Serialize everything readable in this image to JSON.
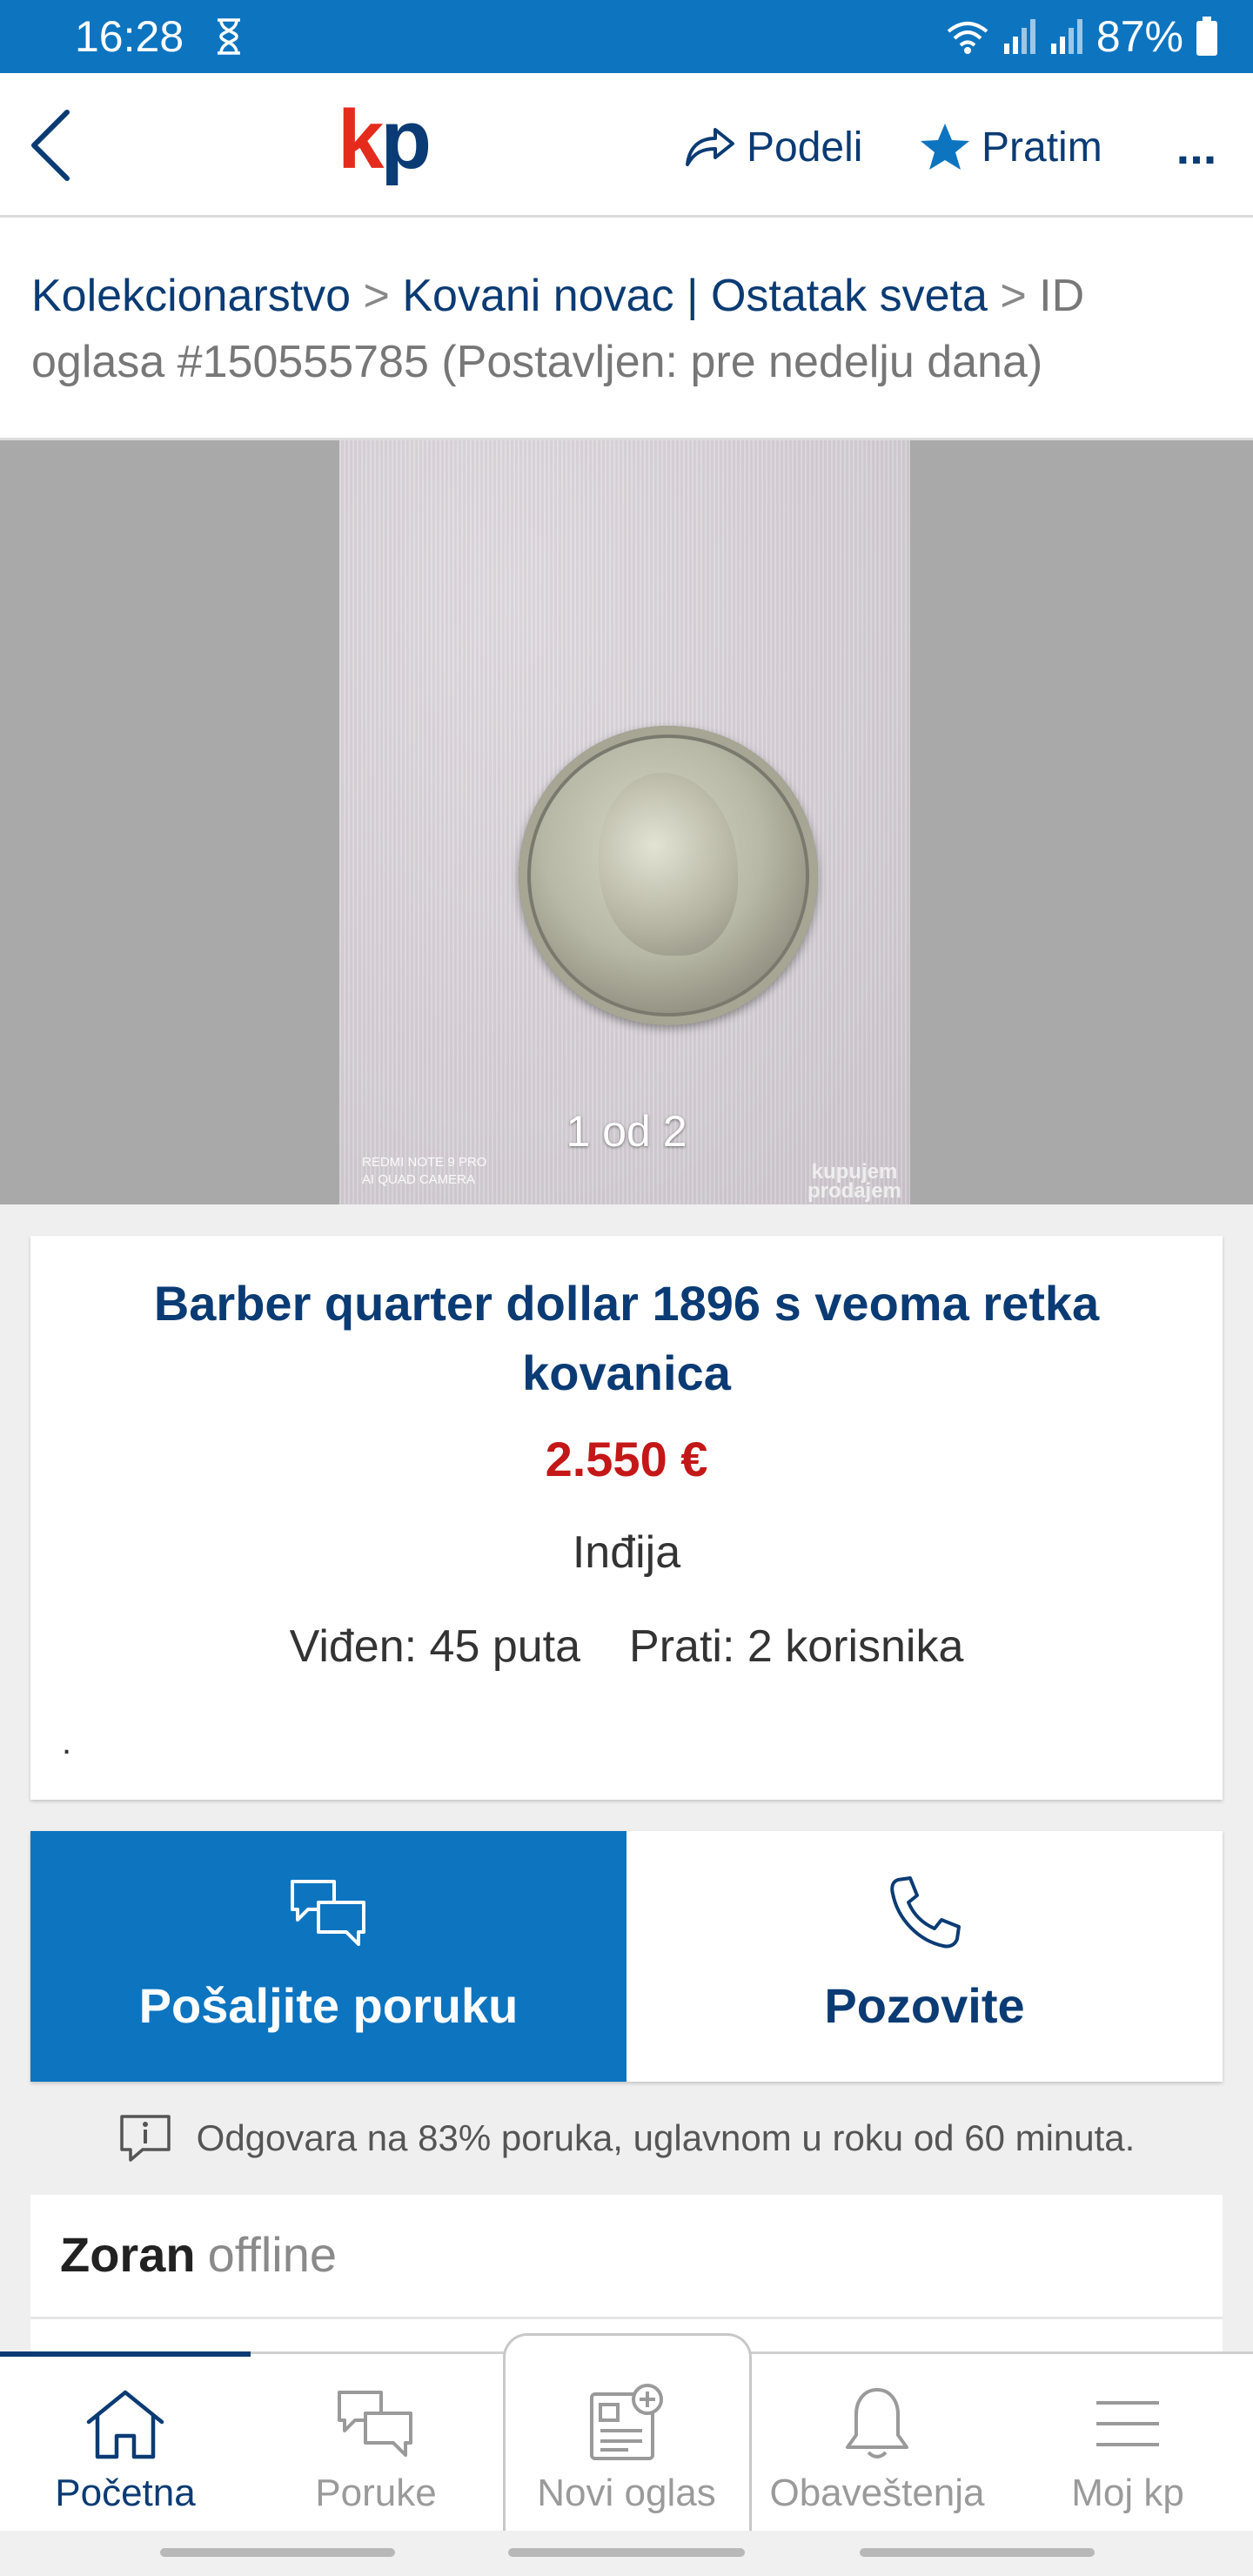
{
  "status_bar": {
    "time": "16:28",
    "battery": "87%"
  },
  "header": {
    "logo_k": "k",
    "logo_p": "p",
    "share_label": "Podeli",
    "follow_label": "Pratim",
    "more_label": "..."
  },
  "breadcrumb": {
    "crumb1": "Kolekcionarstvo",
    "sep1": " > ",
    "crumb2": "Kovani novac | Ostatak sveta",
    "sep2": " > ",
    "tail": "ID oglasa #150555785 (Postavljen: pre nedelju dana)"
  },
  "gallery": {
    "counter": "1 od 2",
    "camera_watermark_1": "REDMI NOTE 9 PRO",
    "camera_watermark_2": "AI QUAD CAMERA",
    "kp_watermark_1": "kupujem",
    "kp_watermark_2": "prodajem"
  },
  "ad": {
    "title": "Barber quarter dollar 1896 s veoma retka kovanica",
    "price": "2.550 €",
    "location": "Inđija",
    "views": "Viđen: 45 puta",
    "followers": "Prati: 2 korisnika",
    "description_dot": "."
  },
  "actions": {
    "message_label": "Pošaljite poruku",
    "call_label": "Pozovite"
  },
  "reply_rate": "Odgovara na 83% poruka, uglavnom u roku od 60 minuta.",
  "seller": {
    "name": "Zoran",
    "status": "offline"
  },
  "bottom_nav": [
    {
      "label": "Početna",
      "icon": "home-icon"
    },
    {
      "label": "Poruke",
      "icon": "chat-icon"
    },
    {
      "label": "Novi oglas",
      "icon": "new-ad-icon"
    },
    {
      "label": "Obaveštenja",
      "icon": "bell-icon"
    },
    {
      "label": "Moj kp",
      "icon": "menu-icon"
    }
  ],
  "colors": {
    "brand_blue": "#0d74c0",
    "navy": "#0b3b74",
    "price_red": "#c41717",
    "logo_red": "#e42b1c"
  }
}
